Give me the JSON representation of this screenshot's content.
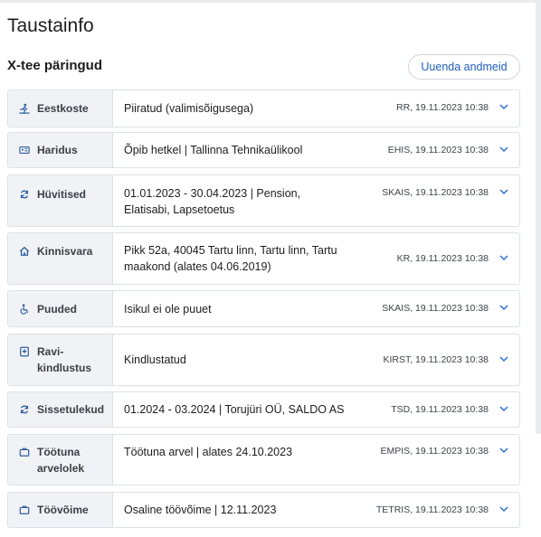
{
  "page": {
    "title": "Taustainfo",
    "section_title": "X-tee päringud",
    "refresh_button": "Uuenda andmeid"
  },
  "rows": [
    {
      "icon": "person-walking-icon",
      "label": "Eestkoste",
      "value": "Piiratud (valimisõigusega)",
      "meta": "RR, 19.11.2023 10:38"
    },
    {
      "icon": "id-card-icon",
      "label": "Haridus",
      "value": "Õpib hetkel | Tallinna Tehnikaülikool",
      "meta": "EHIS, 19.11.2023 10:38"
    },
    {
      "icon": "refresh-icon",
      "label": "Hüvitised",
      "value": "01.01.2023 - 30.04.2023 | Pension, Elatisabi, Lapsetoetus",
      "meta": "SKAIS, 19.11.2023 10:38"
    },
    {
      "icon": "house-icon",
      "label": "Kinnisvara",
      "value": "Pikk 52a, 40045 Tartu linn, Tartu linn, Tartu maakond (alates 04.06.2019)",
      "meta": "KR, 19.11.2023 10:38"
    },
    {
      "icon": "wheelchair-icon",
      "label": "Puuded",
      "value": "Isikul ei ole puuet",
      "meta": "SKAIS, 19.11.2023 10:38"
    },
    {
      "icon": "medical-card-icon",
      "label": "Ravi-kindlustus",
      "label_line1": "Ravi-",
      "label_line2": "kindlustus",
      "value": "Kindlustatud",
      "meta": "KIRST, 19.11.2023 10:38"
    },
    {
      "icon": "refresh-icon",
      "label": "Sissetulekud",
      "value": "01.2024 - 03.2024 | Torujüri OÜ, SALDO AS",
      "meta": "TSD, 19.11.2023 10:38"
    },
    {
      "icon": "briefcase-icon",
      "label": "Töötuna arvelolek",
      "label_line1": "Töötuna",
      "label_line2": "arvelolek",
      "value": "Töötuna arvel | alates 24.10.2023",
      "meta": "EMPIS, 19.11.2023 10:38"
    },
    {
      "icon": "briefcase-icon",
      "label": "Töövõime",
      "value": "Osaline töövõime | 12.11.2023",
      "meta": "TETRIS, 19.11.2023 10:38"
    }
  ],
  "colors": {
    "accent": "#1f5fbf",
    "label_bg": "#f0f2f5",
    "border": "#dde1e7"
  }
}
